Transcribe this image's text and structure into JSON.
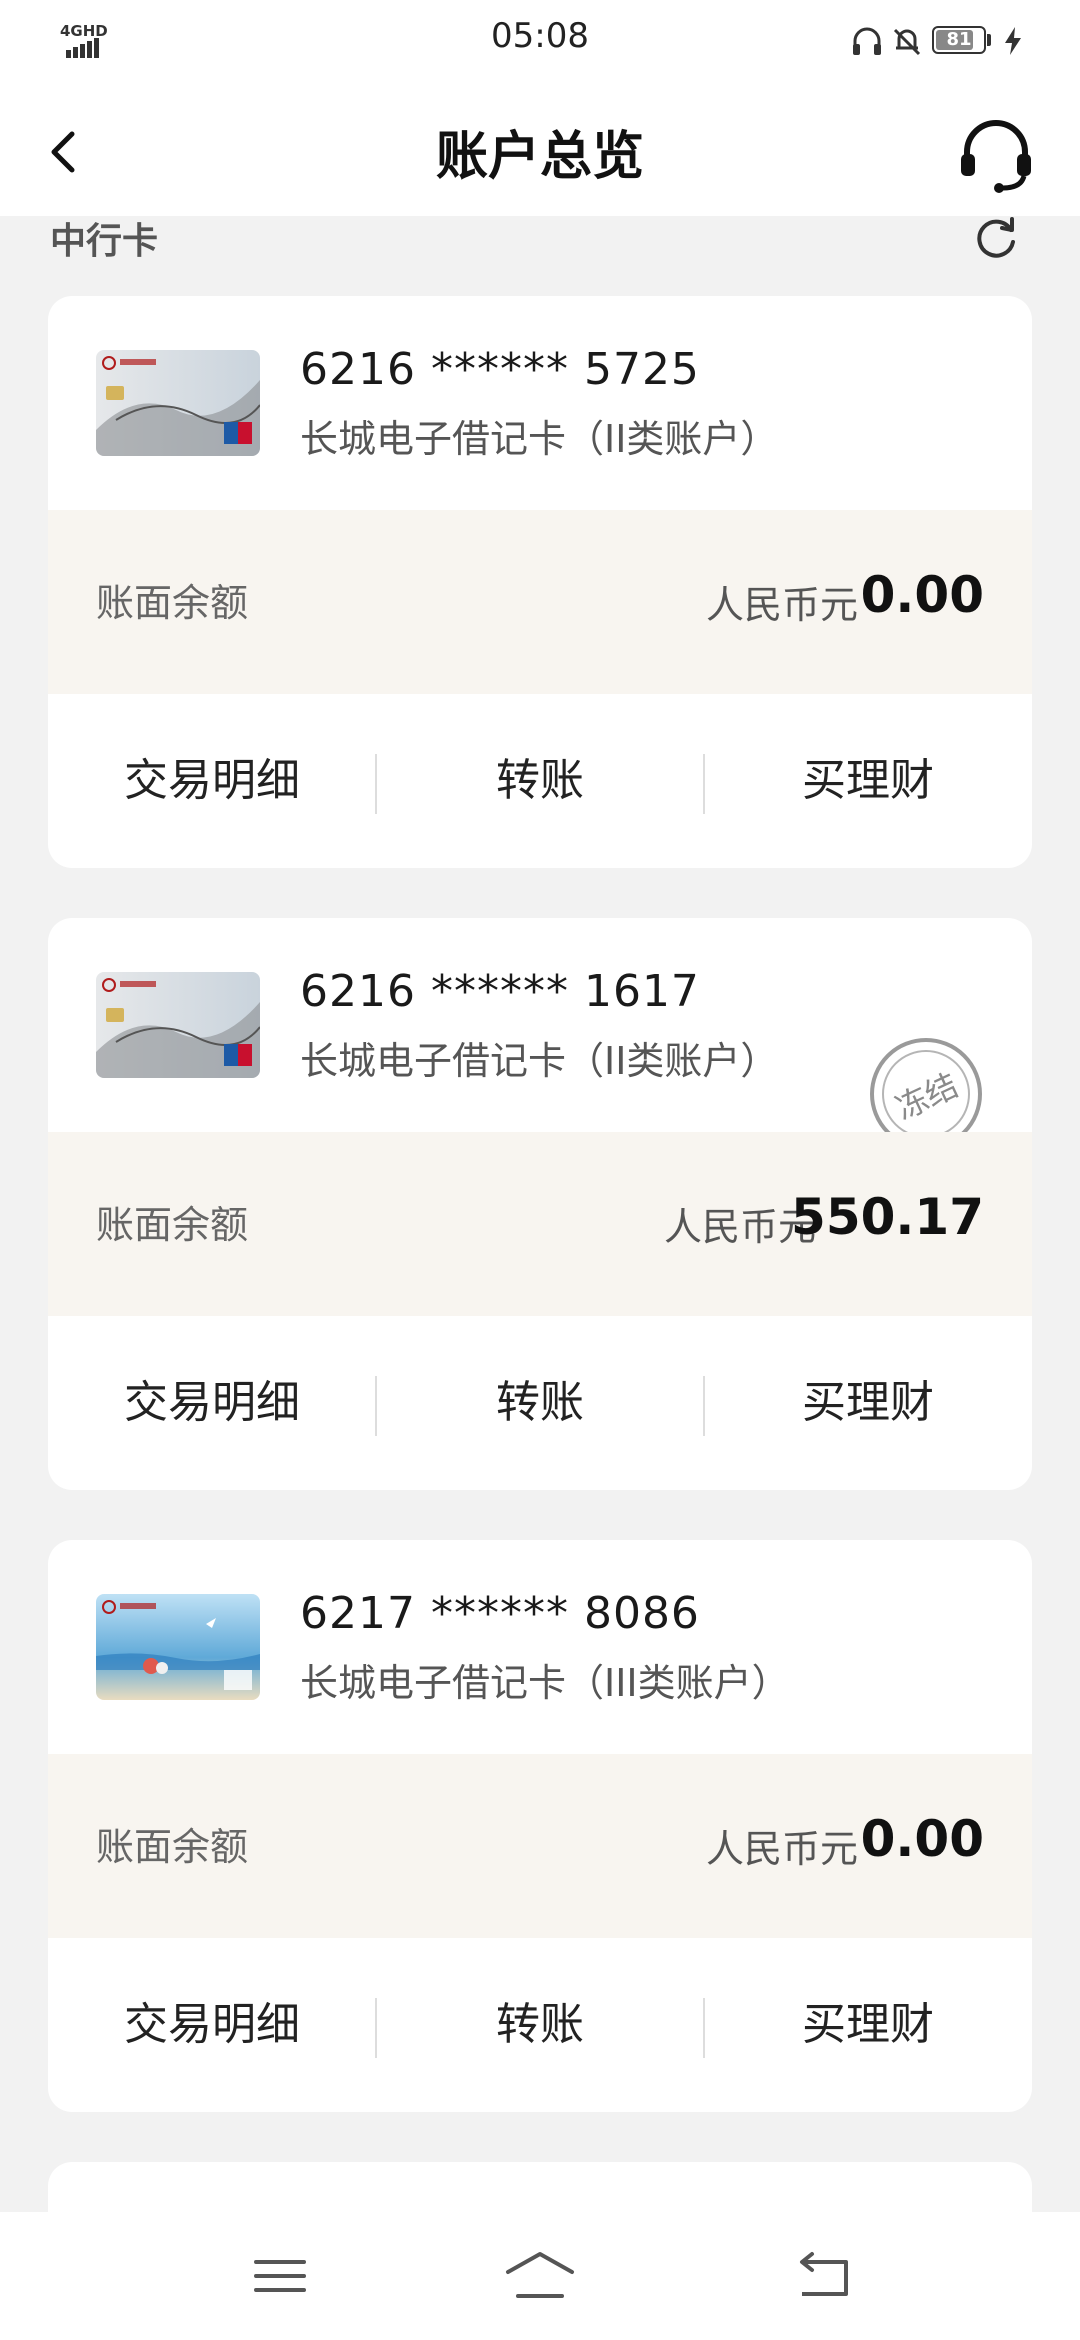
{
  "status_bar": {
    "network": "4GHD",
    "time": "05:08",
    "battery": "81",
    "battery_level": 0.81,
    "icons": [
      "signal-icon",
      "headphones-icon",
      "mute-bell-icon",
      "battery-icon",
      "charging-icon"
    ]
  },
  "header": {
    "title": "账户总览",
    "back_icon": "back-chevron-icon",
    "service_icon": "headset-icon"
  },
  "section": {
    "title": "中行卡",
    "refresh_icon": "refresh-icon"
  },
  "cards": [
    {
      "number": "6216 ****** 5725",
      "type": "长城电子借记卡（II类账户）",
      "balance_label": "账面余额",
      "currency": "人民币元",
      "balance": "0.00",
      "frozen": false,
      "actions": [
        "交易明细",
        "转账",
        "买理财"
      ]
    },
    {
      "number": "6216 ****** 1617",
      "type": "长城电子借记卡（II类账户）",
      "balance_label": "账面余额",
      "currency": "人民币元",
      "balance": "550.17",
      "frozen": true,
      "frozen_label": "冻结",
      "actions": [
        "交易明细",
        "转账",
        "买理财"
      ]
    },
    {
      "number": "6217 ****** 8086",
      "type": "长城电子借记卡（III类账户）",
      "balance_label": "账面余额",
      "currency": "人民币元",
      "balance": "0.00",
      "frozen": false,
      "actions": [
        "交易明细",
        "转账",
        "买理财"
      ]
    }
  ],
  "bottom_nav": [
    "menu-icon",
    "home-icon",
    "return-icon"
  ],
  "colors": {
    "background": "#f2f2f2",
    "card": "#ffffff",
    "balance_row": "#f8f5f0",
    "text": "#1a1a1a"
  }
}
